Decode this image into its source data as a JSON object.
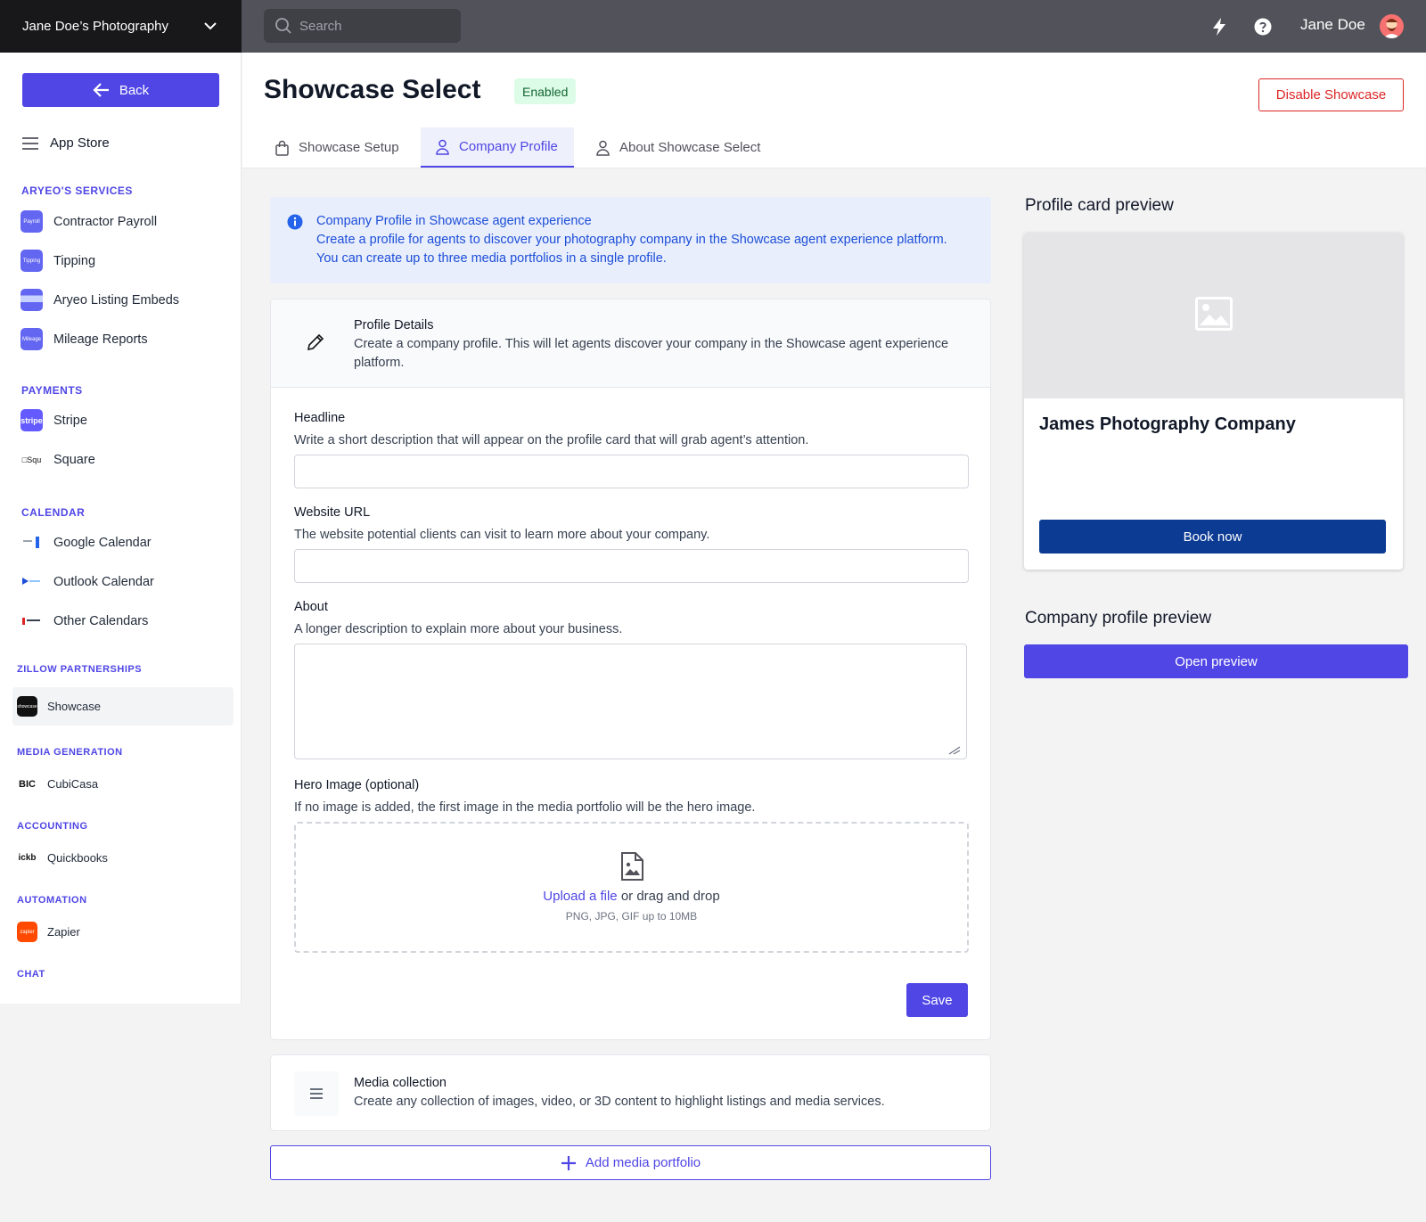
{
  "topbar": {
    "brand": "Jane Doe’s Photography",
    "search_placeholder": "Search",
    "user_name": "Jane Doe"
  },
  "sidebar": {
    "back_label": "Back",
    "app_store_label": "App Store",
    "sections": {
      "services": "ARYEO'S SERVICES",
      "payments": "PAYMENTS",
      "calendar": "CALENDAR",
      "zillow": "ZILLOW PARTNERSHIPS",
      "media_generation": "MEDIA GENERATION",
      "accounting": "ACCOUNTING",
      "automation": "AUTOMATION",
      "chat": "CHAT"
    },
    "items": {
      "contractor_payroll": "Contractor Payroll",
      "tipping": "Tipping",
      "listing_embeds": "Aryeo Listing Embeds",
      "mileage_reports": "Mileage Reports",
      "stripe": "Stripe",
      "square": "Square",
      "google_calendar": "Google Calendar",
      "outlook_calendar": "Outlook Calendar",
      "other_calendars": "Other Calendars",
      "showcase": "Showcase",
      "cubicasa": "CubiCasa",
      "quickbooks": "Quickbooks",
      "zapier": "Zapier"
    }
  },
  "header": {
    "title": "Showcase Select",
    "status_badge": "Enabled",
    "disable_button": "Disable Showcase",
    "tabs": [
      "Showcase Setup",
      "Company Profile",
      "About Showcase Select"
    ],
    "active_tab": "Company Profile"
  },
  "info_banner": {
    "title": "Company Profile in Showcase agent experience",
    "body": "Create a profile for agents to discover your photography company in the Showcase agent experience platform. You can create up to three media portfolios in a single profile."
  },
  "profile_details": {
    "title": "Profile Details",
    "description": "Create a company profile. This will let agents discover your company in the Showcase agent experience platform.",
    "headline_label": "Headline",
    "headline_help": "Write a short description that will appear on the profile card that will grab agent’s attention.",
    "headline_value": "",
    "website_label": "Website URL",
    "website_help": "The website potential clients can visit to learn more about your company.",
    "website_value": "",
    "about_label": "About",
    "about_help": "A longer description to explain more about your business.",
    "about_value": "",
    "hero_label": "Hero Image (optional)",
    "hero_help": "If no image is added, the first image in the media portfolio will be the hero image.",
    "upload_link": "Upload a file",
    "upload_text": " or drag and drop",
    "upload_types": "PNG, JPG, GIF up to 10MB",
    "save_label": "Save"
  },
  "media_collection": {
    "title": "Media collection",
    "description": "Create any collection of images, video, or 3D content to highlight listings and media services.",
    "add_label": "Add media portfolio"
  },
  "preview": {
    "profile_card_title": "Profile card preview",
    "company_name": "James Photography Company",
    "book_label": "Book now",
    "company_profile_title": "Company profile preview",
    "open_label": "Open preview"
  },
  "colors": {
    "accent": "#4f46e5",
    "brand_dark": "#18181b",
    "topbar": "#52525b",
    "book_button": "#0c3b94",
    "danger": "#dc2626",
    "enabled_bg": "#dcfce7"
  }
}
